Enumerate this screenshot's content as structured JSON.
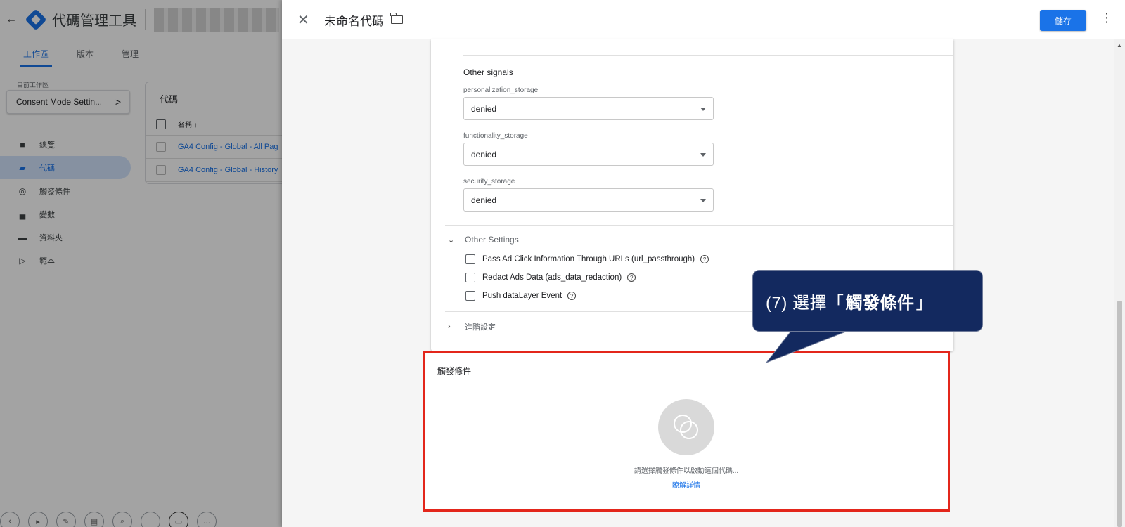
{
  "bg_app": {
    "back_glyph": "←",
    "title": "代碼管理工具",
    "tabs": [
      "工作區",
      "版本",
      "管理"
    ],
    "workspace_label": "目前工作區",
    "workspace_name": "Consent Mode Settin...",
    "workspace_chevron": ">",
    "nav": [
      {
        "label": "總覽",
        "icon": "briefcase-icon"
      },
      {
        "label": "代碼",
        "icon": "tag-icon"
      },
      {
        "label": "觸發條件",
        "icon": "trigger-icon"
      },
      {
        "label": "變數",
        "icon": "variables-icon"
      },
      {
        "label": "資料夾",
        "icon": "folder-icon"
      },
      {
        "label": "範本",
        "icon": "template-icon"
      }
    ],
    "tags_card": {
      "title": "代碼",
      "col_name": "名稱 ↑",
      "rows": [
        "GA4 Config - Global - All Pag",
        "GA4 Config - Global - History"
      ]
    }
  },
  "panel": {
    "close_glyph": "✕",
    "tag_name": "未命名代碼",
    "save_label": "儲存",
    "more_glyph": "⋮",
    "other_signals": {
      "title": "Other signals",
      "fields": [
        {
          "label": "personalization_storage",
          "value": "denied"
        },
        {
          "label": "functionality_storage",
          "value": "denied"
        },
        {
          "label": "security_storage",
          "value": "denied"
        }
      ]
    },
    "other_settings": {
      "title": "Other Settings",
      "checkboxes": [
        "Pass Ad Click Information Through URLs (url_passthrough)",
        "Redact Ads Data (ads_data_redaction)",
        "Push dataLayer Event"
      ]
    },
    "advanced_settings": "進階設定",
    "triggering": {
      "title": "觸發條件",
      "hint": "請選擇觸發條件以啟動這個代碼...",
      "learn_more": "瞭解詳情"
    }
  },
  "callout": {
    "prefix": "(7) 選擇「",
    "bold": "觸發條件",
    "suffix": "」"
  },
  "colors": {
    "accent": "#1a73e8",
    "highlight_border": "#e3261b",
    "callout_bg": "#13295f"
  }
}
